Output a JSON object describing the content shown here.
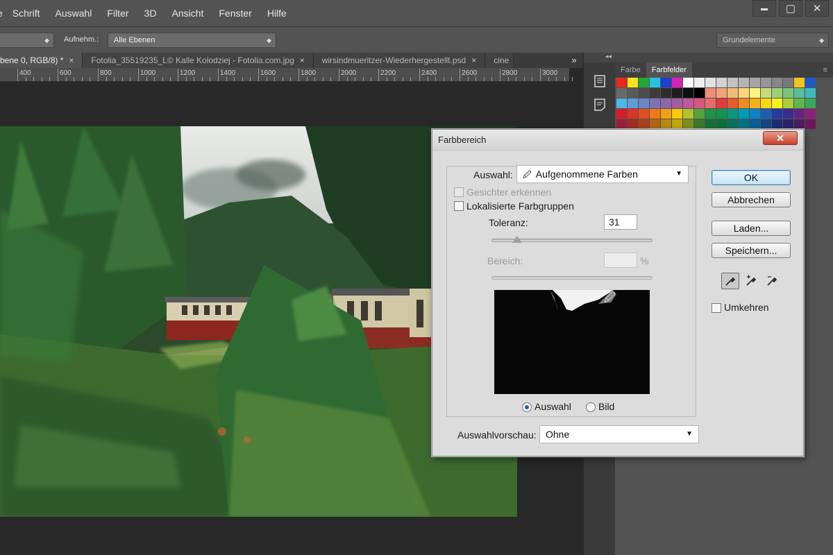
{
  "menu": {
    "partial_first": "e",
    "items": [
      "Schrift",
      "Auswahl",
      "Filter",
      "3D",
      "Ansicht",
      "Fenster",
      "Hilfe"
    ]
  },
  "window_controls": {
    "minimize_glyph": "▬",
    "maximize_glyph": "▢",
    "close_glyph": "✕"
  },
  "options_bar": {
    "label_aufnehm": "Aufnehm.:",
    "sample_value": "Alle Ebenen",
    "workspace": "Grundelemente"
  },
  "tabs": [
    {
      "label": "bene 0, RGB/8) *",
      "close": "×",
      "active": true
    },
    {
      "label": "Fotolia_35519235_L© Kalle Kolodziej - Fotolia.com.jpg",
      "close": "×",
      "active": false
    },
    {
      "label": "wirsindmueritzer-Wiederhergestellt.psd",
      "close": "×",
      "active": false
    },
    {
      "label": "cine",
      "close": "",
      "active": false
    }
  ],
  "tab_overflow": "»",
  "ruler": [
    "400",
    "600",
    "800",
    "1000",
    "1200",
    "1400",
    "1600",
    "1800",
    "2000",
    "2200",
    "2400",
    "2600",
    "2800",
    "3000"
  ],
  "panel": {
    "collapse_glyph": "◂◂",
    "tabs": [
      "Farbe",
      "Farbfelder"
    ],
    "active_tab": "Farbfelder",
    "menu_glyph": "≡"
  },
  "swatch_colors": [
    "#e8261e",
    "#f7e21b",
    "#25a636",
    "#23c3df",
    "#1c3fd1",
    "#d621b8",
    "#ffffff",
    "#f0f0f0",
    "#e1e1e1",
    "#d2d2d2",
    "#c3c3c3",
    "#b4b4b4",
    "#a5a5a5",
    "#969696",
    "#878787",
    "#787878",
    "#f0c519",
    "#2258c9",
    "#696969",
    "#5a5a5a",
    "#4b4b4b",
    "#3c3c3c",
    "#2d2d2d",
    "#1e1e1e",
    "#0f0f0f",
    "#000000",
    "#ee8e75",
    "#f2a37a",
    "#f6bb7b",
    "#fdd57c",
    "#fff47d",
    "#c8db7a",
    "#a0cf78",
    "#7ec478",
    "#5bbe94",
    "#3fb9bb",
    "#4db7e6",
    "#5e9ed9",
    "#6a86c8",
    "#7d72b8",
    "#8e65ae",
    "#a45ba3",
    "#c0589d",
    "#d9577e",
    "#e86a6a",
    "#e33b3b",
    "#e65c2c",
    "#ef8b21",
    "#f4b21a",
    "#fbd80e",
    "#f5f11e",
    "#a9cf3b",
    "#5fb849",
    "#39a85b",
    "#d61d27",
    "#dd3523",
    "#e34d1f",
    "#ec7a16",
    "#f1a111",
    "#f9c80a",
    "#b2c42a",
    "#56a43b",
    "#1d9545",
    "#13954d",
    "#0b9680",
    "#009bb4",
    "#0a83c7",
    "#1a5eb2",
    "#253a9c",
    "#3b2b8f",
    "#62257e",
    "#8c1f7a",
    "#9c1f3f",
    "#a32c1e",
    "#a8421a",
    "#b06515",
    "#b88a11",
    "#c2a70b",
    "#7c8f21",
    "#3d7a2c",
    "#177034",
    "#0f6f3a",
    "#0a6f5e",
    "#057086",
    "#0b5d93",
    "#164586",
    "#1d2d74",
    "#2d226a",
    "#4a1d5e",
    "#6a185b"
  ],
  "dialog": {
    "title": "Farbbereich",
    "close_glyph": "✕",
    "auswahl_label": "Auswahl:",
    "auswahl_value": "Aufgenommene Farben",
    "gesichter": "Gesichter erkennen",
    "lokalisiert": "Lokalisierte Farbgruppen",
    "toleranz_label": "Toleranz:",
    "toleranz_value": "31",
    "bereich_label": "Bereich:",
    "bereich_value": "",
    "percent": "%",
    "radio_auswahl": "Auswahl",
    "radio_bild": "Bild",
    "vorschau_label": "Auswahlvorschau:",
    "vorschau_value": "Ohne",
    "buttons": {
      "ok": "OK",
      "abbrechen": "Abbrechen",
      "laden": "Laden...",
      "speichern": "Speichern..."
    },
    "umkehren": "Umkehren",
    "dropdown_glyph": "▼"
  }
}
